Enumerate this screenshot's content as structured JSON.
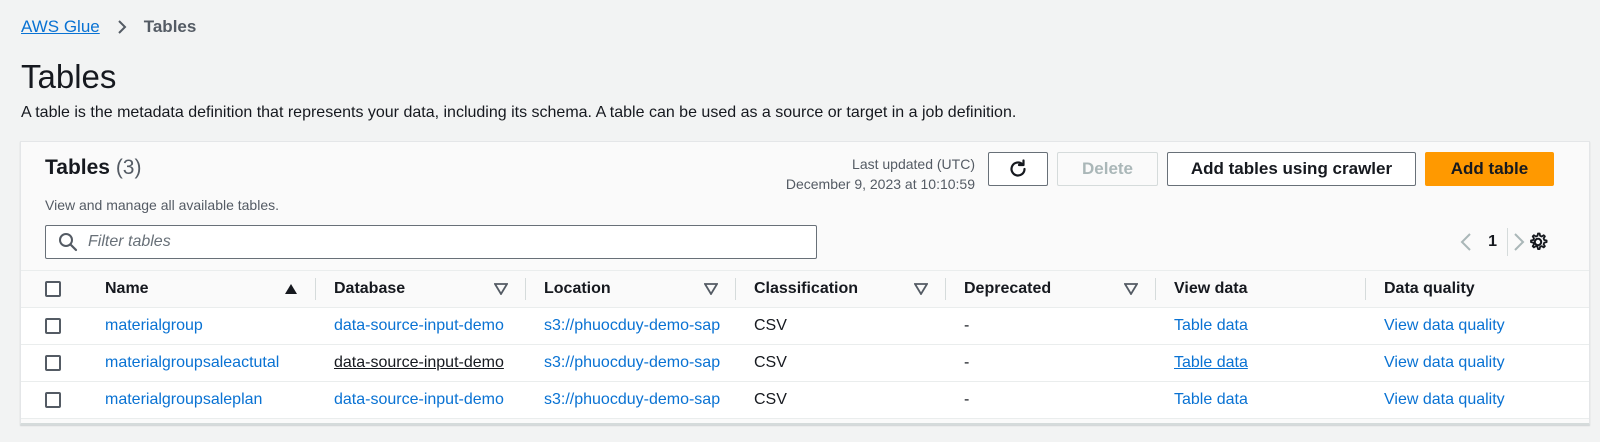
{
  "breadcrumb": {
    "root": "AWS Glue",
    "current": "Tables"
  },
  "page": {
    "title": "Tables",
    "description": "A table is the metadata definition that represents your data, including its schema. A table can be used as a source or target in a job definition."
  },
  "container": {
    "title": "Tables",
    "count": "(3)",
    "description": "View and manage all available tables.",
    "last_updated_label": "Last updated (UTC)",
    "last_updated_value": "December 9, 2023 at 10:10:59",
    "buttons": {
      "delete": "Delete",
      "add_crawler": "Add tables using crawler",
      "add_table": "Add table"
    },
    "filter_placeholder": "Filter tables",
    "page_number": "1"
  },
  "table": {
    "columns": [
      "Name",
      "Database",
      "Location",
      "Classification",
      "Deprecated",
      "View data",
      "Data quality"
    ],
    "rows": [
      {
        "name": "materialgroup",
        "database": "data-source-input-demo",
        "location": "s3://phuocduy-demo-sap",
        "classification": "CSV",
        "deprecated": "-",
        "view_data": "Table data",
        "data_quality": "View data quality"
      },
      {
        "name": "materialgroupsaleactutal",
        "database": "data-source-input-demo",
        "location": "s3://phuocduy-demo-sap",
        "classification": "CSV",
        "deprecated": "-",
        "view_data": "Table data",
        "data_quality": "View data quality"
      },
      {
        "name": "materialgroupsaleplan",
        "database": "data-source-input-demo",
        "location": "s3://phuocduy-demo-sap",
        "classification": "CSV",
        "deprecated": "-",
        "view_data": "Table data",
        "data_quality": "View data quality"
      }
    ]
  },
  "colors": {
    "link": "#0972d3",
    "primary_button": "#ff9900",
    "text": "#16191f",
    "muted": "#545b64"
  },
  "icons": [
    "chevron-right-icon",
    "refresh-icon",
    "search-icon",
    "chevron-left-icon",
    "settings-gear-icon",
    "sort-ascending-icon",
    "filter-triangle-icon"
  ]
}
